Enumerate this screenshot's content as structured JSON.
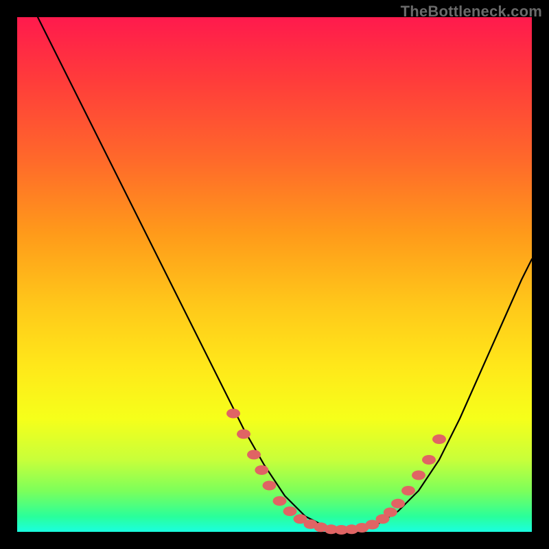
{
  "watermark": "TheBottleneck.com",
  "colors": {
    "frame": "#000000",
    "curve_stroke": "#000000",
    "marker_fill": "#e06464",
    "marker_stroke": "#aa3c3c"
  },
  "chart_data": {
    "type": "line",
    "title": "",
    "xlabel": "",
    "ylabel": "",
    "xlim": [
      0,
      100
    ],
    "ylim": [
      0,
      100
    ],
    "series": [
      {
        "name": "bottleneck-curve",
        "x": [
          4,
          8,
          12,
          16,
          20,
          24,
          28,
          32,
          36,
          40,
          44,
          48,
          52,
          56,
          60,
          62,
          64,
          66,
          70,
          74,
          78,
          82,
          86,
          90,
          94,
          98,
          100
        ],
        "y": [
          100,
          92,
          84,
          76,
          68,
          60,
          52,
          44,
          36,
          28,
          20,
          13,
          7,
          3,
          1,
          0.5,
          0.4,
          0.5,
          1.5,
          4,
          8,
          14,
          22,
          31,
          40,
          49,
          53
        ]
      }
    ],
    "markers": [
      {
        "x": 42,
        "y": 23
      },
      {
        "x": 44,
        "y": 19
      },
      {
        "x": 46,
        "y": 15
      },
      {
        "x": 47.5,
        "y": 12
      },
      {
        "x": 49,
        "y": 9
      },
      {
        "x": 51,
        "y": 6
      },
      {
        "x": 53,
        "y": 4
      },
      {
        "x": 55,
        "y": 2.5
      },
      {
        "x": 57,
        "y": 1.5
      },
      {
        "x": 59,
        "y": 0.9
      },
      {
        "x": 61,
        "y": 0.5
      },
      {
        "x": 63,
        "y": 0.4
      },
      {
        "x": 65,
        "y": 0.5
      },
      {
        "x": 67,
        "y": 0.8
      },
      {
        "x": 69,
        "y": 1.4
      },
      {
        "x": 71,
        "y": 2.5
      },
      {
        "x": 72.5,
        "y": 3.8
      },
      {
        "x": 74,
        "y": 5.5
      },
      {
        "x": 76,
        "y": 8
      },
      {
        "x": 78,
        "y": 11
      },
      {
        "x": 80,
        "y": 14
      },
      {
        "x": 82,
        "y": 18
      }
    ]
  }
}
